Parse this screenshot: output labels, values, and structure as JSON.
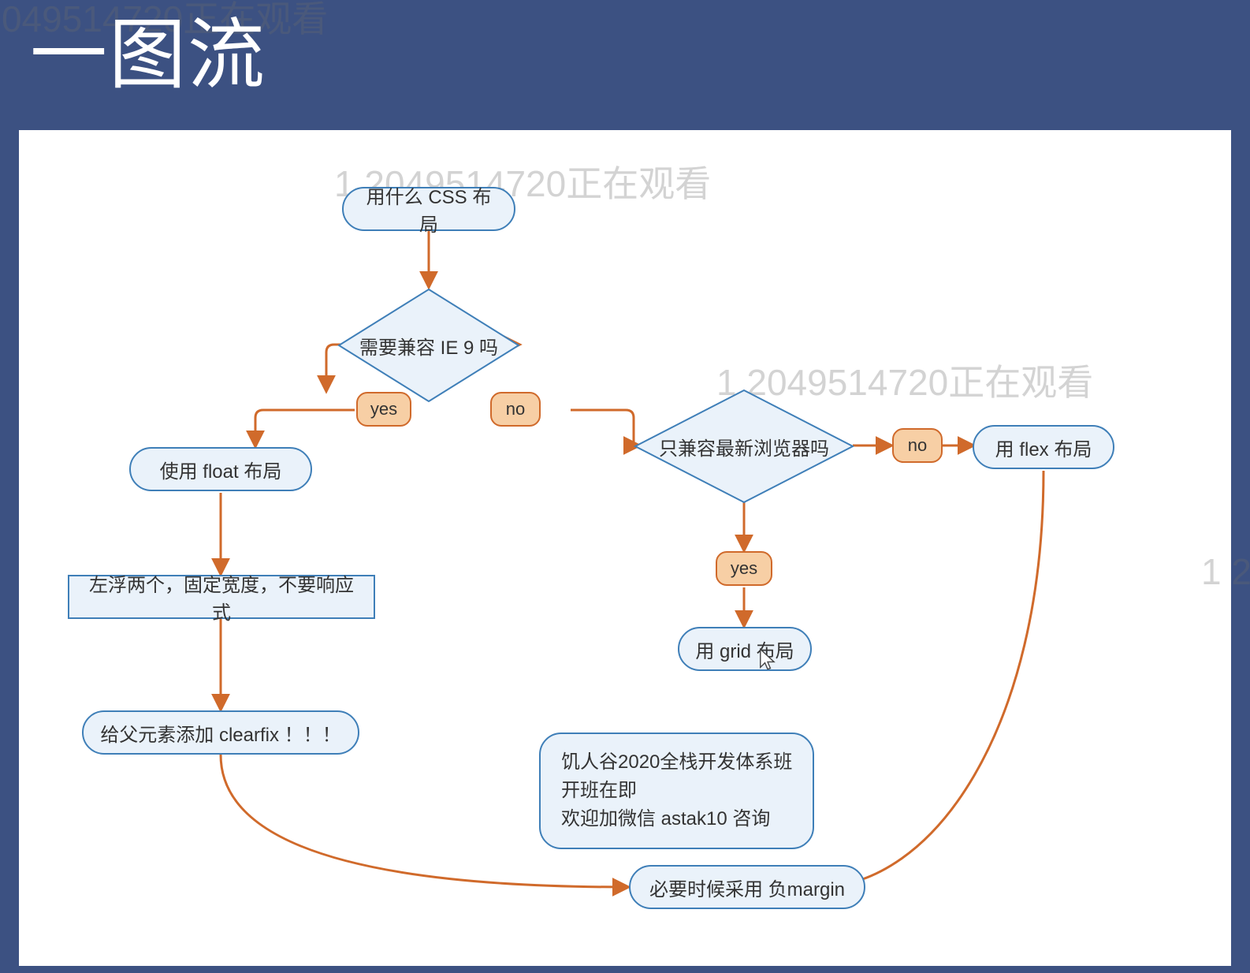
{
  "title": "一图流",
  "watermark": "1 2049514720正在观看",
  "flow": {
    "start": "用什么 CSS 布局",
    "decision1": "需要兼容 IE 9 吗",
    "yes": "yes",
    "no": "no",
    "float": "使用 float 布局",
    "floatNote": "左浮两个，固定宽度，不要响应式",
    "clearfix": "给父元素添加 clearfix ！！！",
    "decision2": "只兼容最新浏览器吗",
    "flex": "用 flex 布局",
    "grid": "用 grid 布局",
    "margin": "必要时候采用 负margin"
  },
  "info": "饥人谷2020全栈开发体系班\n开班在即\n欢迎加微信 astak10 咨询",
  "colors": {
    "bg": "#3c5182",
    "nodeFill": "#eaf2fa",
    "nodeStroke": "#3f7fb8",
    "labelFill": "#f7cfa5",
    "labelStroke": "#d06a2b",
    "arrow": "#d06a2b"
  }
}
